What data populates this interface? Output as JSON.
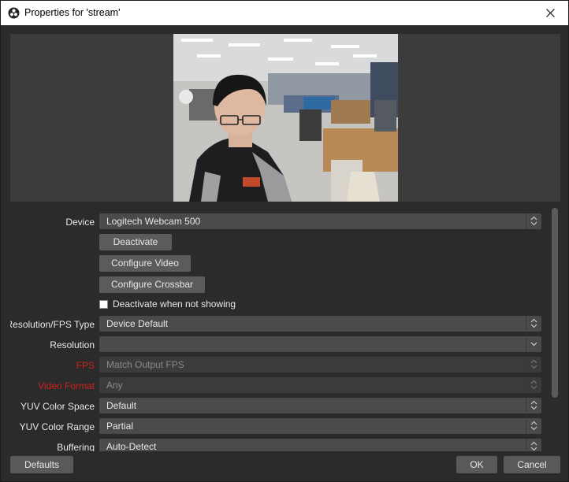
{
  "window": {
    "title": "Properties for 'stream'",
    "title_icon": "obs-logo-icon",
    "close_icon": "close-icon"
  },
  "preview": {
    "description": "webcam-preview"
  },
  "properties": {
    "device": {
      "label": "Device",
      "value": "Logitech Webcam 500",
      "control": "select"
    },
    "deactivate_button": "Deactivate",
    "configure_video_button": "Configure Video",
    "configure_crossbar_button": "Configure Crossbar",
    "deactivate_when_not_showing": {
      "label": "Deactivate when not showing",
      "checked": false
    },
    "resolution_fps_type": {
      "label": "Resolution/FPS Type",
      "value": "Device Default"
    },
    "resolution": {
      "label": "Resolution",
      "value": ""
    },
    "fps": {
      "label": "FPS",
      "value": "Match Output FPS",
      "enabled": false,
      "label_color": "#d21f1f"
    },
    "video_format": {
      "label": "Video Format",
      "value": "Any",
      "enabled": false,
      "label_color": "#d21f1f"
    },
    "yuv_color_space": {
      "label": "YUV Color Space",
      "value": "Default"
    },
    "yuv_color_range": {
      "label": "YUV Color Range",
      "value": "Partial"
    },
    "buffering": {
      "label": "Buffering",
      "value": "Auto-Detect"
    }
  },
  "footer": {
    "defaults_button": "Defaults",
    "ok_button": "OK",
    "cancel_button": "Cancel"
  },
  "colors": {
    "background": "#2b2b2b",
    "field": "#4a4a4a",
    "button": "#5b5b5b",
    "warning_label": "#d21f1f"
  }
}
